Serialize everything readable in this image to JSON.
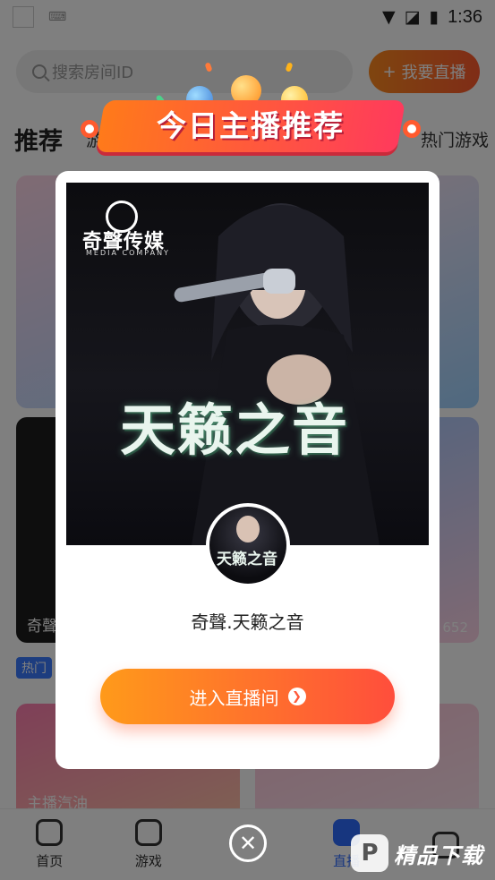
{
  "statusbar": {
    "time": "1:36"
  },
  "topbar": {
    "search_placeholder": "搜索房间ID",
    "live_button": "我要直播"
  },
  "categories": {
    "main": "推荐",
    "sub": "游戏",
    "right": "热门游戏"
  },
  "cards": {
    "c3_title": "奇聲",
    "c4_count": "652",
    "hot_badge": "热门",
    "c5_title": "主播汽油"
  },
  "nav": {
    "items": [
      {
        "label": "首页"
      },
      {
        "label": "游戏"
      },
      {
        "label": ""
      },
      {
        "label": "直播"
      },
      {
        "label": ""
      }
    ]
  },
  "banner": {
    "text": "今日主播推荐"
  },
  "modal": {
    "poster_brand": "奇聲传媒",
    "poster_brand_en": "MEDIA COMPANY",
    "poster_title": "天籁之音",
    "avatar_title": "天籁之音",
    "room_name": "奇聲.天籁之音",
    "enter_button": "进入直播间"
  },
  "watermark": {
    "text": "精品下载"
  },
  "colors": {
    "accent_orange": "#ff8a1f",
    "accent_red": "#ff4e3c",
    "nav_active": "#2f6cff"
  }
}
